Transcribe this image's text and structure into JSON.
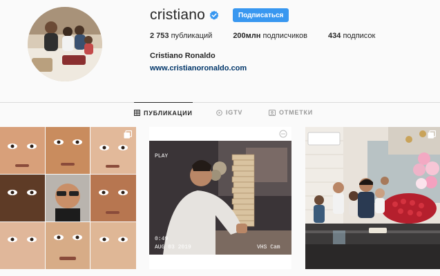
{
  "profile": {
    "username": "cristiano",
    "follow_label": "Подписаться",
    "stats": {
      "posts_count": "2 753",
      "posts_label": "публикаций",
      "followers_count": "200млн",
      "followers_label": "подписчиков",
      "following_count": "434",
      "following_label": "подписок"
    },
    "full_name": "Cristiano Ronaldo",
    "website": "www.cristianoronaldo.com"
  },
  "tabs": [
    {
      "label": "ПУБЛИКАЦИИ",
      "icon": "grid-icon",
      "active": true
    },
    {
      "label": "IGTV",
      "icon": "igtv-icon",
      "active": false
    },
    {
      "label": "ОТМЕТКИ",
      "icon": "tag-icon",
      "active": false
    }
  ],
  "posts": [
    {
      "type": "image",
      "icon": "multi-photo-icon"
    },
    {
      "type": "video",
      "overlay_top": "PLAY",
      "overlay_time": "0:49",
      "overlay_date": "AUG 03 2019",
      "overlay_cam": "VHS Cam",
      "icon": "igtv-badge-icon"
    },
    {
      "type": "image",
      "icon": "multi-photo-icon"
    }
  ],
  "colors": {
    "accent": "#3897f0",
    "link": "#003569",
    "background": "#fafafa",
    "divider": "#dbdbdb"
  }
}
